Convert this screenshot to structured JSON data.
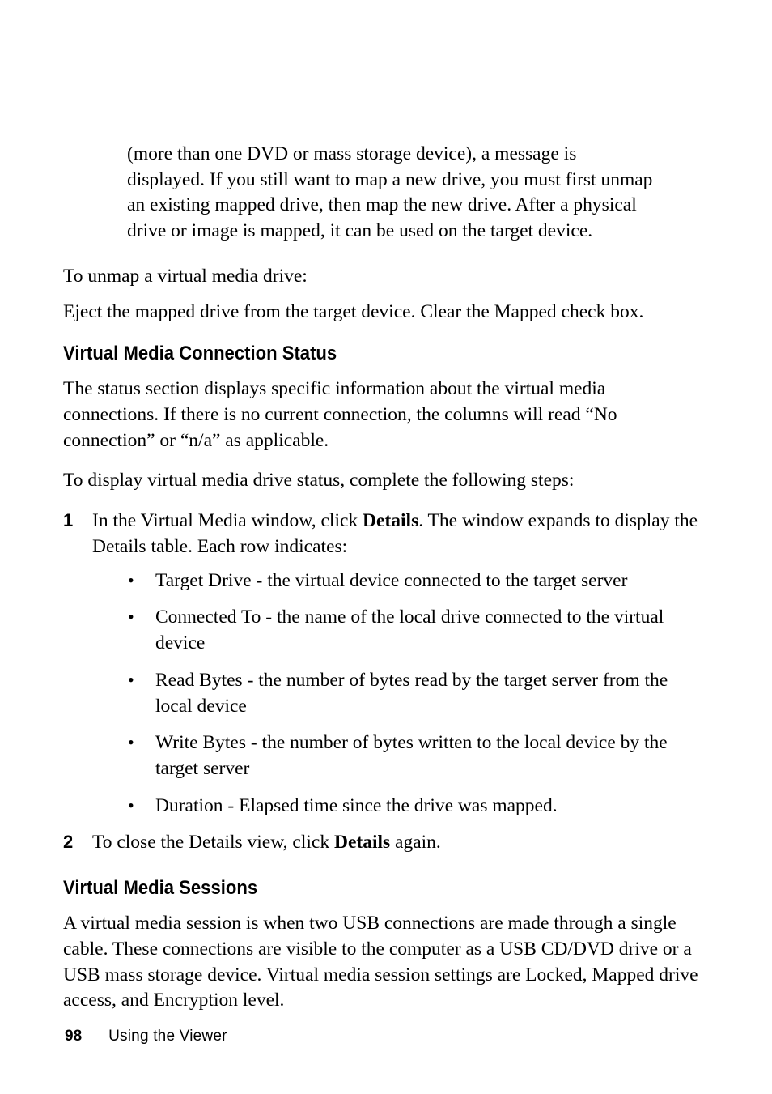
{
  "intro_block": "(more than one DVD or mass storage device), a message is displayed. If you still want to map a new drive, you must first unmap an existing mapped drive, then map the new drive. After a physical drive or image is mapped, it can be used on the target device.",
  "unmap_line": "To unmap a virtual media drive:",
  "eject_line": "Eject the mapped drive from the target device. Clear the Mapped check box.",
  "section1": {
    "heading": "Virtual Media Connection Status",
    "para1": "The status section displays specific information about the virtual media connections. If there is no current connection, the columns will read “No connection” or “n/a” as applicable.",
    "para2": "To display virtual media drive status, complete the following steps:",
    "step1_prefix": "In the Virtual Media window, click ",
    "step1_bold": "Details",
    "step1_suffix": ". The window expands to display the Details table. Each row indicates:",
    "bullets": [
      "Target Drive - the virtual device connected to the target server",
      "Connected To - the name of the local drive connected to the virtual device",
      "Read Bytes - the number of bytes read by the target server from the local device",
      "Write Bytes - the number of bytes written to the local device by the target server",
      "Duration - Elapsed time since the drive was mapped."
    ],
    "step2_prefix": "To close the Details view, click ",
    "step2_bold": "Details",
    "step2_suffix": " again."
  },
  "section2": {
    "heading": "Virtual Media Sessions",
    "para": "A virtual media session is when two USB connections are made through a single cable. These connections are visible to the computer as a USB CD/DVD drive or a USB mass storage device. Virtual media session settings are Locked, Mapped drive access, and Encryption level."
  },
  "footer": {
    "page": "98",
    "section": "Using the Viewer"
  }
}
